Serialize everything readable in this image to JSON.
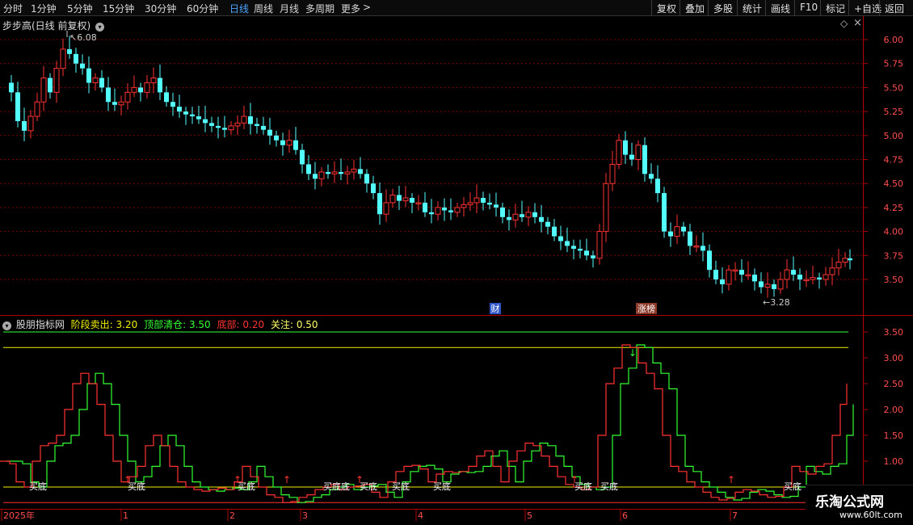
{
  "toolbar": {
    "periods": [
      "分时",
      "1分钟",
      "5分钟",
      "15分钟",
      "30分钟",
      "60分钟",
      "日线",
      "周线",
      "月线",
      "多周期",
      "更多"
    ],
    "active_period": "日线",
    "more_arrow": ">",
    "right_buttons": [
      "复权",
      "叠加",
      "多股",
      "统计",
      "画线",
      "F10",
      "标记",
      "+自选",
      "返回"
    ]
  },
  "main_chart": {
    "title": "步步高(日线 前复权)",
    "collapse_icon": "chevron-down-icon",
    "diamond_icon": "diamond-icon",
    "close_icon": "close-icon",
    "price_axis": [
      "6.00",
      "5.75",
      "5.50",
      "5.25",
      "5.00",
      "4.75",
      "4.50",
      "4.25",
      "4.00",
      "3.75",
      "3.50"
    ],
    "high_marker": "6.08",
    "low_marker": "3.28",
    "badges": [
      {
        "label": "财",
        "color": "#2f56c8"
      },
      {
        "label": "涨榜",
        "color": "#8b3a2a"
      }
    ]
  },
  "indicator": {
    "name": "股朋指标网",
    "fields": [
      {
        "label": "阶段卖出:",
        "value": "3.20",
        "color": "#f0f000"
      },
      {
        "label": "顶部清仓:",
        "value": "3.50",
        "color": "#33ff33"
      },
      {
        "label": "底部:",
        "value": "0.20",
        "color": "#ff3333"
      },
      {
        "label": "关注:",
        "value": "0.50",
        "color": "#ffff66"
      }
    ],
    "axis": [
      "3.50",
      "3.00",
      "2.50",
      "2.00",
      "1.50",
      "1.00"
    ],
    "buy_label": "买底",
    "buy_labels": [
      "买底",
      "买底",
      "买底",
      "买底底",
      "买底",
      "买底",
      "买底",
      "买底",
      "买底",
      "买底"
    ]
  },
  "time_axis": [
    "2025年",
    "1",
    "2",
    "3",
    "4",
    "5",
    "6",
    "7"
  ],
  "colors": {
    "up": "#ff3232",
    "down": "#54ffff",
    "grid": "#7a0000",
    "axis_text": "#ff4d4d",
    "level_green": "#33ff33",
    "level_yellow": "#f0f000",
    "level_red": "#ff3333"
  },
  "watermark": {
    "title": "乐淘公式网",
    "url": "www.60lt.com"
  }
}
